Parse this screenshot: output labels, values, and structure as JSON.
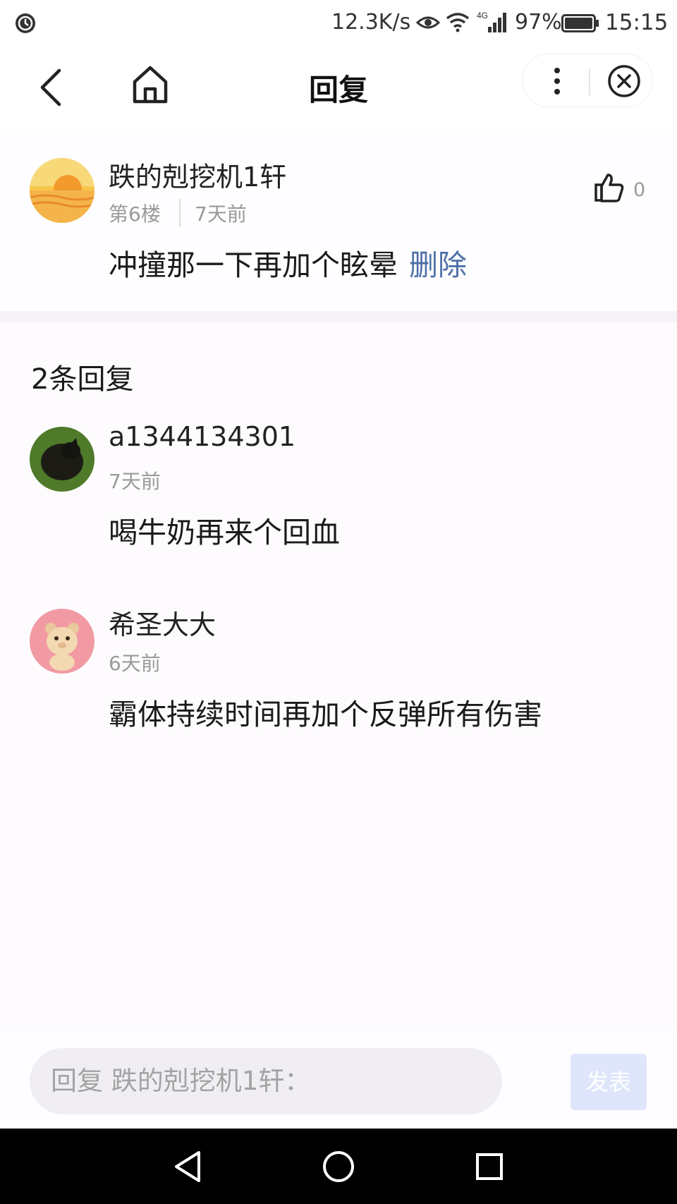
{
  "status_bar": {
    "speed": "12.3K/s",
    "network_badge": "4G",
    "battery": "97%",
    "time": "15:15"
  },
  "nav": {
    "title": "回复"
  },
  "main_post": {
    "username": "跌的剋挖机1轩",
    "floor": "第6楼",
    "time": "7天前",
    "content": "冲撞那一下再加个眩晕",
    "delete_label": "删除",
    "like_count": "0"
  },
  "replies": {
    "count_label": "2条回复",
    "items": [
      {
        "username": "a1344134301",
        "time": "7天前",
        "content": "喝牛奶再来个回血"
      },
      {
        "username": "希圣大大",
        "time": "6天前",
        "content": "霸体持续时间再加个反弹所有伤害"
      }
    ]
  },
  "reply_bar": {
    "placeholder": "回复 跌的剋挖机1轩：",
    "send_label": "发表"
  },
  "colors": {
    "link": "#4d6fa6",
    "send_button_bg": "#dfe6fb",
    "input_bg": "#f0eef2"
  }
}
